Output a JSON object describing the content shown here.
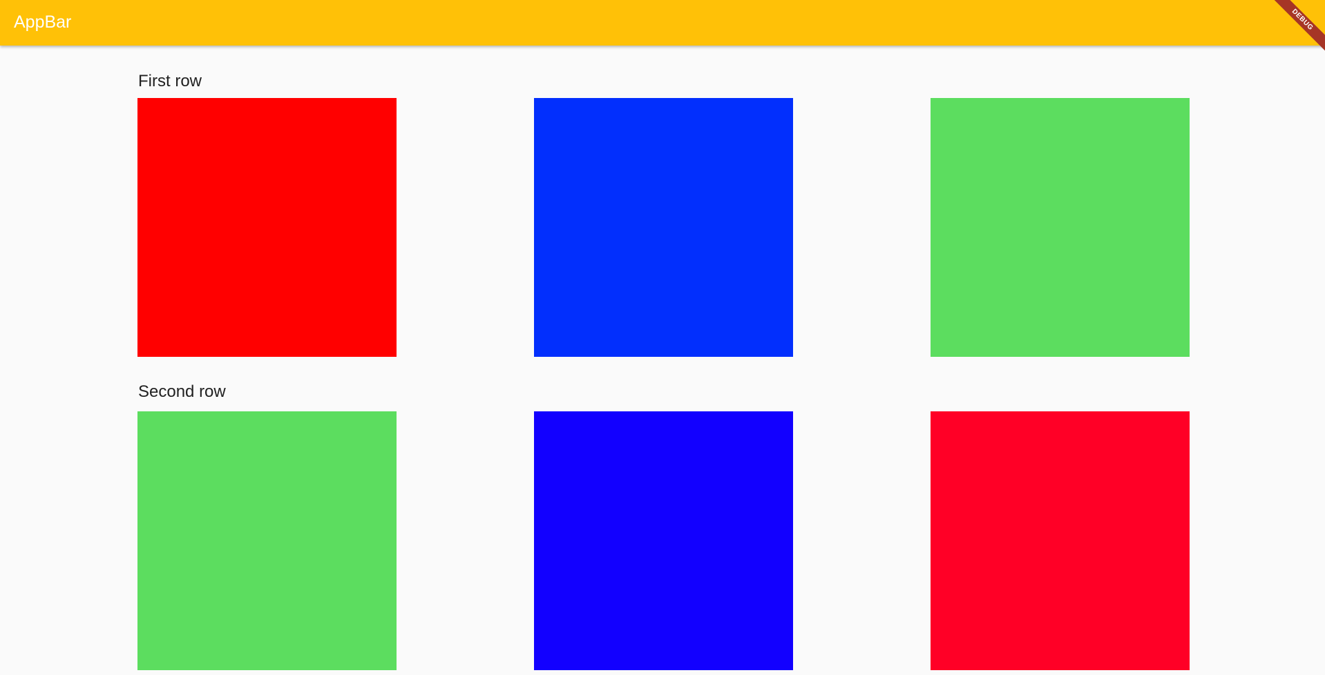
{
  "appbar": {
    "title": "AppBar",
    "color": "#ffc107"
  },
  "debug_banner": {
    "label": "DEBUG",
    "color": "#a63526"
  },
  "rows": [
    {
      "label": "First row",
      "boxes": [
        {
          "color": "#ff0000"
        },
        {
          "color": "#022ffd"
        },
        {
          "color": "#5cdd5f"
        }
      ]
    },
    {
      "label": "Second row",
      "boxes": [
        {
          "color": "#5cdd5f"
        },
        {
          "color": "#1200ff"
        },
        {
          "color": "#ff0026"
        }
      ]
    }
  ]
}
